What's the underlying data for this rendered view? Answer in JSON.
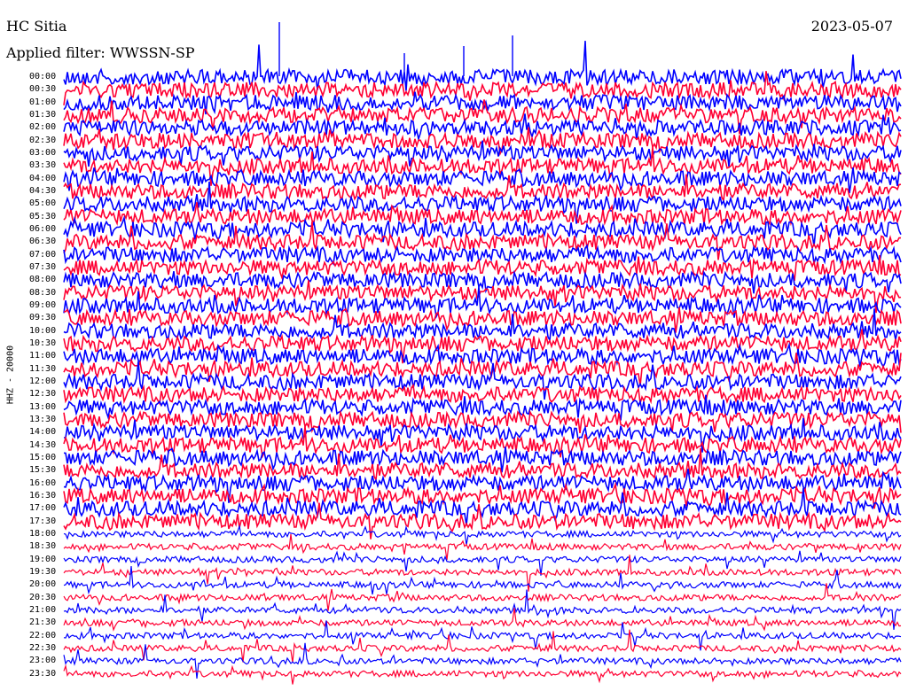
{
  "header": {
    "station": "HC Sitia",
    "date": "2023-05-07",
    "filter": "Applied filter: WWSSN-SP"
  },
  "chart_data": {
    "type": "line",
    "ylabel": "HHZ - 20000",
    "y_tick_labels": [
      "00:00",
      "00:30",
      "01:00",
      "01:30",
      "02:00",
      "02:30",
      "03:00",
      "03:30",
      "04:00",
      "04:30",
      "05:00",
      "05:30",
      "06:00",
      "06:30",
      "07:00",
      "07:30",
      "08:00",
      "08:30",
      "09:00",
      "09:30",
      "10:00",
      "10:30",
      "11:00",
      "11:30",
      "12:00",
      "12:30",
      "13:00",
      "13:30",
      "14:00",
      "14:30",
      "15:00",
      "15:30",
      "16:00",
      "16:30",
      "17:00",
      "17:30",
      "18:00",
      "18:30",
      "19:00",
      "19:30",
      "20:00",
      "20:30",
      "21:00",
      "21:30",
      "22:00",
      "22:30",
      "23:00",
      "23:30"
    ],
    "series_colors": [
      "#0000ff",
      "#ff0033"
    ],
    "background": "#ffffff",
    "grid": false
  }
}
